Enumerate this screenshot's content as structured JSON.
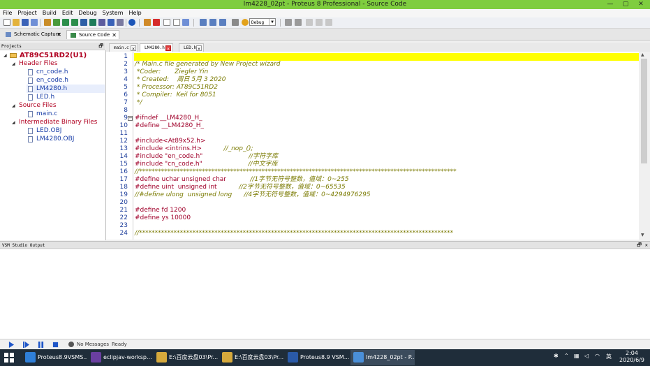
{
  "window": {
    "title": "lm4228_02pt - Proteus 8 Professional - Source Code",
    "controls": [
      "—",
      "▢",
      "✕"
    ]
  },
  "menu": [
    "File",
    "Project",
    "Build",
    "Edit",
    "Debug",
    "System",
    "Help"
  ],
  "toolbar": {
    "build_config": "Debug"
  },
  "page_tabs": [
    {
      "label": "Schematic Capture",
      "close": "✕"
    },
    {
      "label": "Source Code",
      "close": "✕"
    }
  ],
  "projects_panel": {
    "title": "Projects",
    "pin": "🗗",
    "root": "AT89C51RD2(U1)",
    "groups": [
      {
        "label": "Header Files",
        "files": [
          "cn_code.h",
          "en_code.h",
          "LM4280.h",
          "LED.h"
        ]
      },
      {
        "label": "Source Files",
        "files": [
          "main.c"
        ]
      },
      {
        "label": "Intermediate Binary Files",
        "files": [
          "LED.OBJ",
          "LM4280.OBJ"
        ]
      }
    ]
  },
  "editor_tabs": [
    {
      "label": "main.c",
      "close": "×"
    },
    {
      "label": "LM4280.h",
      "close": "×",
      "active": true
    },
    {
      "label": "LED.h",
      "close": "×"
    }
  ],
  "editor": {
    "fold_marker": "−",
    "lines": [
      {
        "n": "1",
        "t": "",
        "k": "pp"
      },
      {
        "n": "2",
        "t": "/* Main.c file generated by New Project wizard",
        "k": "cm"
      },
      {
        "n": "3",
        "t": " *Coder:       Ziegler Yin",
        "k": "cm"
      },
      {
        "n": "4",
        "t": " * Created:    周日 5月 3 2020",
        "k": "cm"
      },
      {
        "n": "5",
        "t": " * Processor: AT89C51RD2",
        "k": "cm"
      },
      {
        "n": "6",
        "t": " * Compiler:  Keil for 8051",
        "k": "cm"
      },
      {
        "n": "7",
        "t": " */",
        "k": "cm"
      },
      {
        "n": "8",
        "t": "",
        "k": "pp"
      },
      {
        "n": "9",
        "t": "#ifndef __LM4280_H_",
        "k": "pp"
      },
      {
        "n": "10",
        "t": "#define __LM4280_H_",
        "k": "pp"
      },
      {
        "n": "11",
        "t": "",
        "k": "pp"
      },
      {
        "n": "12",
        "t": "#include<At89x52.h>",
        "k": "pp"
      },
      {
        "n": "13",
        "t": "#include <intrins.H>           //_nop_();",
        "k": "mix",
        "a": "#include <intrins.H>           ",
        "b": "//_nop_();"
      },
      {
        "n": "14",
        "t": "#include \"en_code.h\"                       //字符字库",
        "k": "mix",
        "a": "#include \"en_code.h\"                       ",
        "b": "//字符字库"
      },
      {
        "n": "15",
        "t": "#include \"cn_code.h\"                       //中文字库",
        "k": "mix",
        "a": "#include \"cn_code.h\"                       ",
        "b": "//中文字库"
      },
      {
        "n": "16",
        "t": "//*****************************************************************************************************",
        "k": "cm"
      },
      {
        "n": "17",
        "t": "#define uchar unsigned char            //1字节无符号整数，值域：0~255",
        "k": "mix",
        "a": "#define uchar unsigned char            ",
        "b": "//1字节无符号整数，值域：0~255"
      },
      {
        "n": "18",
        "t": "#define uint  unsigned int           //2字节无符号整数，值域：0~65535",
        "k": "mix",
        "a": "#define uint  unsigned int           ",
        "b": "//2字节无符号整数，值域：0~65535"
      },
      {
        "n": "19",
        "t": "//#define ulong  unsigned long      //4字节无符号整数，值域：0~4294976295",
        "k": "cm"
      },
      {
        "n": "20",
        "t": "",
        "k": "pp"
      },
      {
        "n": "21",
        "t": "#define fd 1200",
        "k": "pp"
      },
      {
        "n": "22",
        "t": "#define ys 10000",
        "k": "pp"
      },
      {
        "n": "23",
        "t": "",
        "k": "pp"
      },
      {
        "n": "24",
        "t": "//****************************************************************************************************",
        "k": "cm"
      }
    ]
  },
  "output_panel": {
    "title": "VSM Studio Output",
    "pin": "🗗",
    "close": "✕"
  },
  "status_bar": {
    "messages": "No Messages",
    "state": "Ready"
  },
  "taskbar": {
    "tasks": [
      {
        "label": "Proteus8.9VSMS...",
        "color": "#2f7fd8"
      },
      {
        "label": "eclipjav-worksp...",
        "color": "#6a3fa0"
      },
      {
        "label": "E:\\百度云盘03\\Pr...",
        "color": "#d6a93c"
      },
      {
        "label": "E:\\百度云盘03\\Pr...",
        "color": "#d6a93c"
      },
      {
        "label": "Proteus8.9 VSM...",
        "color": "#2a5aa8"
      },
      {
        "label": "lm4228_02pt - P...",
        "color": "#4a8fd8",
        "active": true
      }
    ],
    "time": "2:04",
    "date": "2020/6/9",
    "ime": "英"
  },
  "colors": {
    "titlebar": "#7fcd3f",
    "current_line": "#ffff00",
    "comment": "#7a7a00",
    "preprocessor": "#a0002a",
    "line_number": "#1c3d9a",
    "tree_folder": "#b00020",
    "tree_file": "#1b3fa8",
    "taskbar": "#1f2d3a"
  }
}
